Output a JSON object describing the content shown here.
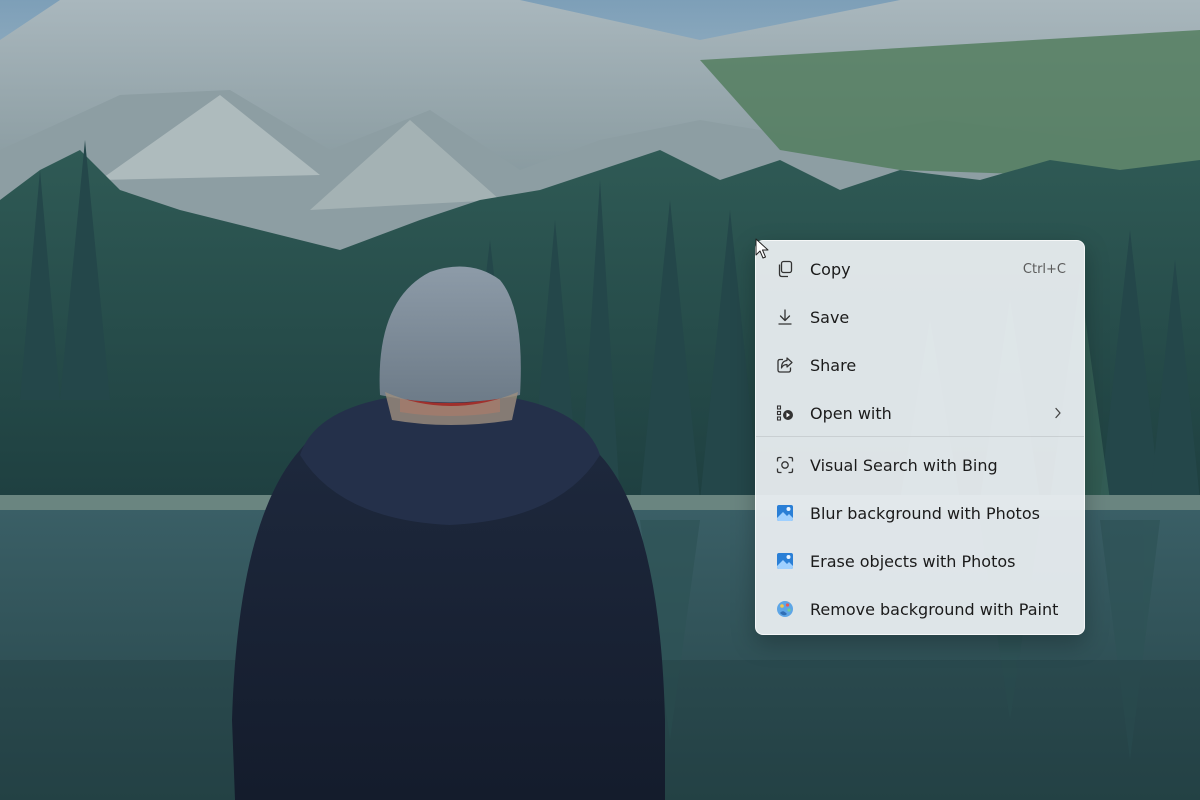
{
  "context_menu": {
    "items": [
      {
        "label": "Copy",
        "shortcut": "Ctrl+C",
        "icon": "copy-icon"
      },
      {
        "label": "Save",
        "icon": "download-icon"
      },
      {
        "label": "Share",
        "icon": "share-icon"
      },
      {
        "label": "Open with",
        "icon": "open-with-icon",
        "has_submenu": true
      },
      {
        "label": "Visual Search with Bing",
        "icon": "visual-search-icon"
      },
      {
        "label": "Blur background with Photos",
        "icon": "photos-icon"
      },
      {
        "label": "Erase objects with Photos",
        "icon": "photos-icon"
      },
      {
        "label": "Remove background with Paint",
        "icon": "paint-icon"
      }
    ]
  },
  "colors": {
    "menu_background": "#ECF0F3",
    "text": "#1B1B1B",
    "photos_icon": "#2A7FD6"
  }
}
